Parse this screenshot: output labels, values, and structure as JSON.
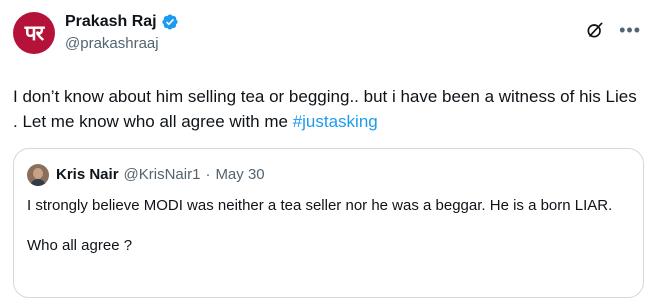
{
  "author": {
    "avatar_text": "पर",
    "display_name": "Prakash Raj",
    "handle": "@prakashraaj",
    "verified": true
  },
  "icons": {
    "grok": "grok-icon",
    "more": "more-icon",
    "verified": "verified-badge-icon"
  },
  "colors": {
    "accent": "#1d9bf0",
    "secondary_text": "#536471",
    "border": "#cfd9de"
  },
  "tweet": {
    "text_before_hashtag": "I don’t know about him selling tea or begging.. but i have been a witness of his Lies . Let me know who all agree with me ",
    "hashtag": "#justasking"
  },
  "quoted_tweet": {
    "display_name": "Kris Nair",
    "handle": "@KrisNair1",
    "separator": "·",
    "date": "May 30",
    "line1": "I strongly believe MODI was neither a tea seller nor he was a beggar. He is a born LIAR.",
    "line2": "Who all agree ?"
  }
}
